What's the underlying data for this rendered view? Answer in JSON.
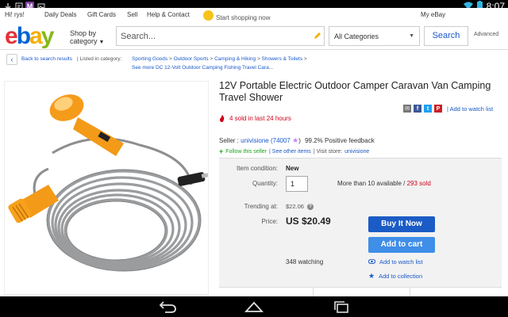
{
  "statusbar": {
    "time": "8:07",
    "left_icons": [
      "download-icon",
      "notification-icon",
      "m-app-icon",
      "image-icon"
    ],
    "m_glyph": "M",
    "right_icons": [
      "wifi-icon",
      "battery-icon"
    ]
  },
  "topstrip": {
    "greeting": "Hi! rys!",
    "links": [
      "Daily Deals",
      "Gift Cards",
      "Sell",
      "Help & Contact"
    ],
    "promo": "Start shopping now",
    "myebay": "My eBay"
  },
  "header": {
    "logo_letters": [
      "e",
      "b",
      "a",
      "y"
    ],
    "logo_colors": [
      "#e53238",
      "#0064d2",
      "#f5af02",
      "#86b817"
    ],
    "shop_by": "Shop by",
    "category": "category",
    "search_placeholder": "Search...",
    "category_select": "All Categories",
    "search_button": "Search",
    "advanced": "Advanced"
  },
  "breadcrumbs": {
    "back": "Back to search results",
    "listed_in": "| Listed in category:",
    "path": [
      "Sporting Goods",
      "Outdoor Sports",
      "Camping & Hiking",
      "Showers & Toilets"
    ],
    "separator": ">",
    "see_more": "See more DC 12-Volt Outdoor Camping Fishing Travel Cara..."
  },
  "product": {
    "title": "12V Portable Electric Outdoor Camper Caravan Van Camping Travel Shower",
    "share_icons": [
      "email-icon",
      "facebook-icon",
      "twitter-icon",
      "pinterest-icon"
    ],
    "share_glyphs": [
      "✉",
      "f",
      "t",
      "P"
    ],
    "add_to_watch": "| Add to watch list",
    "sold_text": "4 sold in last 24 hours",
    "seller_label": "Seller :",
    "seller_name": "univisione",
    "seller_score": "(74007",
    "seller_score_close": ")",
    "feedback": "99.2% Positive feedback",
    "follow": "Follow this seller",
    "see_other": "| See other items",
    "visit_label": "| Visit store:",
    "store": "univisione"
  },
  "panel": {
    "condition_label": "Item condition:",
    "condition_value": "New",
    "quantity_label": "Quantity:",
    "quantity_value": "1",
    "available": "More than 10 available / ",
    "sold_count": "293 sold",
    "trending_label": "Trending at:",
    "trending_value": "$22.06",
    "price_label": "Price:",
    "price_value": "US $20.49",
    "buy_now": "Buy It Now",
    "add_cart": "Add to cart",
    "watching": "348 watching",
    "add_watch": "Add to watch list",
    "add_collection": "Add to collection"
  },
  "navbar": {
    "icons": [
      "back-icon",
      "home-icon",
      "recents-icon"
    ]
  }
}
